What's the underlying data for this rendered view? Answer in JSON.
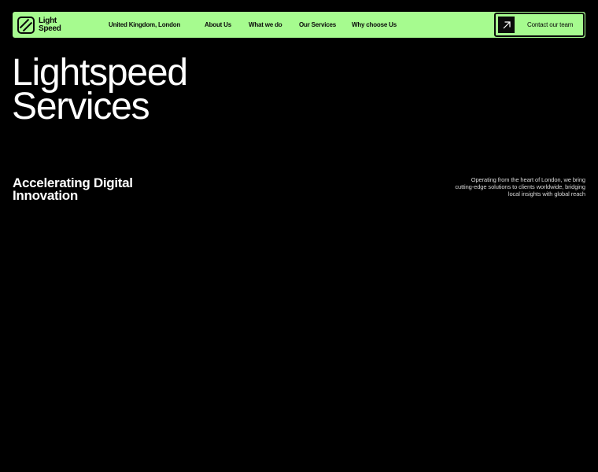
{
  "navbar": {
    "logo": {
      "line1": "Light",
      "line2": "Speed",
      "icon": "lightspeed-logo-icon"
    },
    "location": "United Kingdom, London",
    "links": [
      {
        "label": "About Us"
      },
      {
        "label": "What we do"
      },
      {
        "label": "Our Services"
      },
      {
        "label": "Why choose Us"
      }
    ],
    "contact": {
      "label": "Contact our team",
      "icon": "arrow-up-right-icon"
    }
  },
  "hero": {
    "title_line1": "Lightspeed",
    "title_line2": "Services",
    "tagline_line1": "Accelerating Digital",
    "tagline_line2": "Innovation",
    "description_lines": [
      "Operating from the heart of London, we bring",
      "cutting-edge solutions to clients worldwide, bridging",
      "local insights with global reach"
    ]
  },
  "colors": {
    "accent": "#a6fb8f",
    "background": "#000000",
    "text": "#ffffff",
    "dark": "#0a0a0a"
  }
}
